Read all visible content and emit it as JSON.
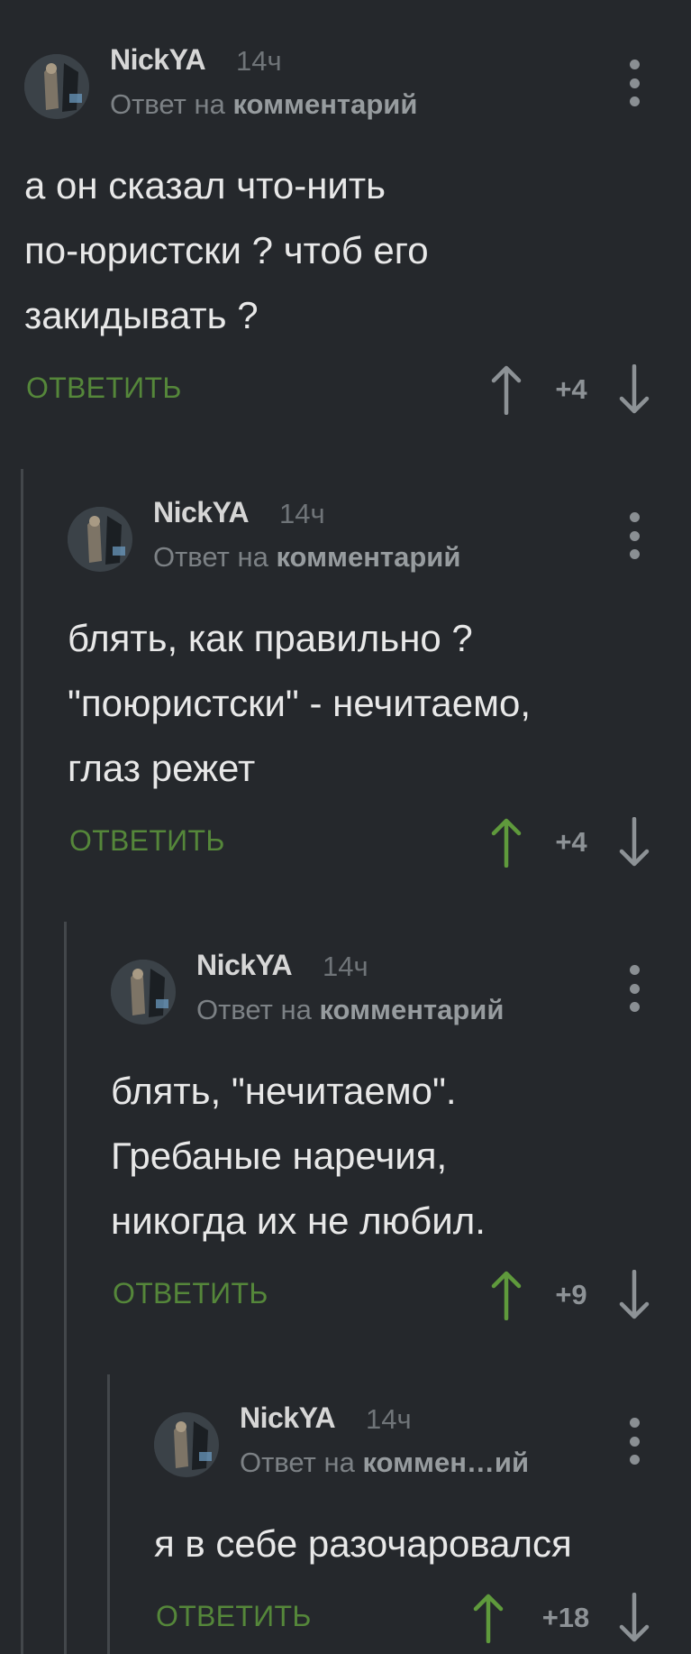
{
  "comments": [
    {
      "author": "NickYA",
      "time": "14ч",
      "reply_prefix": "Ответ на",
      "reply_target": "комментарий",
      "lines": [
        "а он сказал что-нить",
        "по-юристски ? чтоб его",
        "закидывать ?"
      ],
      "reply_label": "ОТВЕТИТЬ",
      "score": "+4",
      "upvoted": false
    },
    {
      "author": "NickYA",
      "time": "14ч",
      "reply_prefix": "Ответ на",
      "reply_target": "комментарий",
      "lines": [
        "блять, как правильно ?",
        "\"поюристски\" - нечитаемо,",
        "глаз режет"
      ],
      "reply_label": "ОТВЕТИТЬ",
      "score": "+4",
      "upvoted": true
    },
    {
      "author": "NickYA",
      "time": "14ч",
      "reply_prefix": "Ответ на",
      "reply_target": "комментарий",
      "lines": [
        "блять,  \"нечитаемо\".",
        "Гребаные наречия,",
        "никогда их не любил."
      ],
      "reply_label": "ОТВЕТИТЬ",
      "score": "+9",
      "upvoted": true
    },
    {
      "author": "NickYA",
      "time": "14ч",
      "reply_prefix": "Ответ на",
      "reply_target": "коммен…ий",
      "lines": [
        "я в себе разочаровался"
      ],
      "reply_label": "ОТВЕТИТЬ",
      "score": "+18",
      "upvoted": true
    }
  ],
  "colors": {
    "background": "#25282c",
    "reply_green": "#55873a",
    "upvote_active": "#5f9a3c",
    "vote_inactive": "#8d9296",
    "thread_line": "#43474b"
  },
  "icons": {
    "upvote": "arrow-up-icon",
    "downvote": "arrow-down-icon",
    "menu": "more-vertical-icon"
  }
}
